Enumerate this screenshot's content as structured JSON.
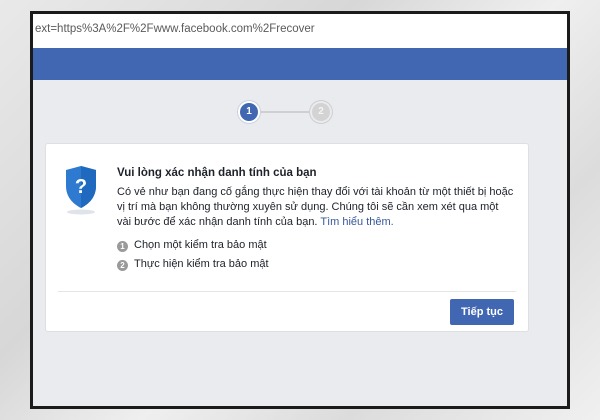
{
  "browser": {
    "url": "ext=https%3A%2F%2Fwww.facebook.com%2Frecover"
  },
  "steps": [
    {
      "number": "1",
      "state": "active"
    },
    {
      "number": "2",
      "state": "inactive"
    }
  ],
  "dialog": {
    "title": "Vui lòng xác nhận danh tính của bạn",
    "description": "Có vẻ như bạn đang cố gắng thực hiện thay đổi với tài khoản từ một thiết bị hoặc vị trí mà bạn không thường xuyên sử dụng. Chúng tôi sẽ cần xem xét qua một vài bước để xác nhận danh tính của bạn.",
    "learn_more": "Tìm hiểu thêm.",
    "items": [
      {
        "number": "1",
        "label": "Chọn một kiểm tra bảo mật"
      },
      {
        "number": "2",
        "label": "Thực hiện kiểm tra bảo mật"
      }
    ],
    "continue_label": "Tiếp tục",
    "shield_icon_glyph": "?"
  },
  "colors": {
    "brand": "#4267b2",
    "link": "#365899",
    "background": "#e9ebee"
  }
}
